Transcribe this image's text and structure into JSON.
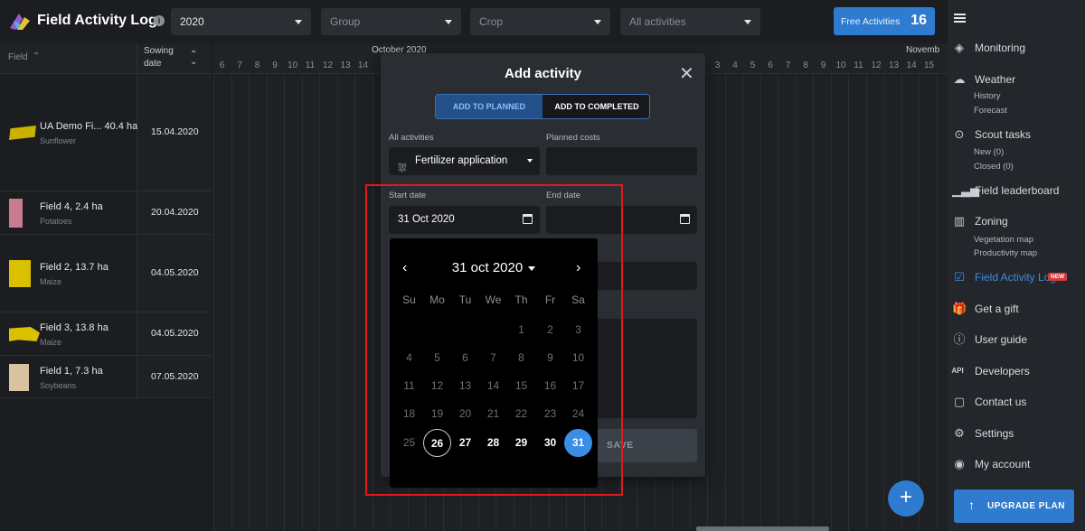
{
  "app": {
    "title": "Field Activity Log",
    "info": "i"
  },
  "filters": {
    "year": "2020",
    "group_placeholder": "Group",
    "crop_placeholder": "Crop",
    "activities_placeholder": "All activities"
  },
  "free_activities": {
    "label": "Free Activities",
    "count": "16"
  },
  "table": {
    "field_header": "Field",
    "sowing_header": "Sowing date",
    "months": [
      "October 2020",
      "Novemb"
    ],
    "days_oct": [
      "6",
      "7",
      "8",
      "9",
      "10",
      "11",
      "12",
      "13",
      "14"
    ],
    "days_nov": [
      "3",
      "4",
      "5",
      "6",
      "7",
      "8",
      "9",
      "10",
      "11",
      "12",
      "13",
      "14",
      "15"
    ],
    "rows": [
      {
        "name": "UA Demo Fi...",
        "area": "40.4 ha",
        "crop": "Sunflower",
        "sowing": "15.04.2020",
        "color": "#c9b100"
      },
      {
        "name": "Field 4, 2.4 ha",
        "area": "",
        "crop": "Potatoes",
        "sowing": "20.04.2020",
        "color": "#c97b8f"
      },
      {
        "name": "Field 2, 13.7 ha",
        "area": "",
        "crop": "Maize",
        "sowing": "04.05.2020",
        "color": "#d9c000"
      },
      {
        "name": "Field 3, 13.8 ha",
        "area": "",
        "crop": "Maize",
        "sowing": "04.05.2020",
        "color": "#d9c000"
      },
      {
        "name": "Field 1, 7.3 ha",
        "area": "",
        "crop": "Soybeans",
        "sowing": "07.05.2020",
        "color": "#d8c2a0"
      }
    ]
  },
  "sidebar": {
    "monitoring": "Monitoring",
    "weather": "Weather",
    "weather_sub": [
      "History",
      "Forecast"
    ],
    "scout": "Scout tasks",
    "scout_sub": [
      "New (0)",
      "Closed (0)"
    ],
    "leaderboard": "Field leaderboard",
    "zoning": "Zoning",
    "zoning_sub": [
      "Vegetation map",
      "Productivity map"
    ],
    "fal": "Field Activity Log",
    "fal_badge": "NEW",
    "gift": "Get a gift",
    "guide": "User guide",
    "api_tag": "API",
    "developers": "Developers",
    "contact": "Contact us",
    "settings": "Settings",
    "account": "My account",
    "upgrade": "UPGRADE PLAN"
  },
  "modal": {
    "title": "Add activity",
    "tab_planned": "ADD TO PLANNED",
    "tab_completed": "ADD TO COMPLETED",
    "activities_label": "All activities",
    "activity_value": "Fertilizer application",
    "costs_label": "Planned costs",
    "start_label": "Start date",
    "start_value": "31 Oct 2020",
    "end_label": "End date",
    "save": "SAVE"
  },
  "datepicker": {
    "month_label": "31 oct 2020",
    "weekdays": [
      "Su",
      "Mo",
      "Tu",
      "We",
      "Th",
      "Fr",
      "Sa"
    ],
    "weeks": [
      [
        "",
        "",
        "",
        "",
        "1",
        "2",
        "3"
      ],
      [
        "4",
        "5",
        "6",
        "7",
        "8",
        "9",
        "10"
      ],
      [
        "11",
        "12",
        "13",
        "14",
        "15",
        "16",
        "17"
      ],
      [
        "18",
        "19",
        "20",
        "21",
        "22",
        "23",
        "24"
      ],
      [
        "25",
        "26",
        "27",
        "28",
        "29",
        "30",
        "31"
      ]
    ],
    "today": "26",
    "selected": "31",
    "current_range": [
      "26",
      "27",
      "28",
      "29",
      "30",
      "31"
    ]
  }
}
